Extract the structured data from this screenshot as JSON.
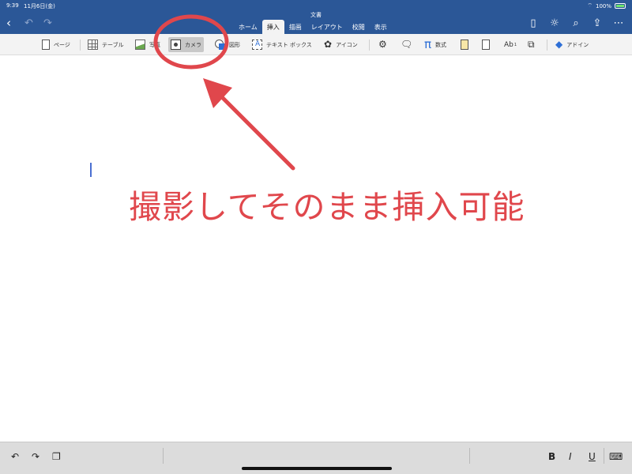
{
  "status_bar": {
    "time": "9:39",
    "date": "11月6日(金)",
    "battery": "100%"
  },
  "document": {
    "title": "文書"
  },
  "tabs": [
    {
      "label": "ホーム",
      "active": false
    },
    {
      "label": "挿入",
      "active": true
    },
    {
      "label": "描画",
      "active": false
    },
    {
      "label": "レイアウト",
      "active": false
    },
    {
      "label": "校閲",
      "active": false
    },
    {
      "label": "表示",
      "active": false
    }
  ],
  "ribbon": {
    "page": "ページ",
    "table": "テーブル",
    "photo": "写真",
    "camera": "カメラ",
    "shape": "図形",
    "textbox": "テキスト ボックス",
    "icon": "アイコン",
    "equation_symbol": "π",
    "equation": "数式",
    "wordart": "Ab",
    "wordart_sup": "1",
    "addin": "アドイン"
  },
  "annotation": {
    "text": "撮影してそのまま挿入可能",
    "color": "#e0474c"
  },
  "bottom_toolbar": {
    "bold": "B",
    "italic": "I",
    "underline": "U"
  },
  "colors": {
    "titlebar": "#2b5797",
    "ribbon": "#f3f3f3",
    "accent_red": "#e0474c"
  }
}
